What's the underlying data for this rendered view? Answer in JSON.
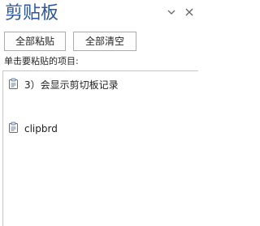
{
  "pane": {
    "title": "剪贴板",
    "icons": {
      "options": "chevron-down-icon",
      "close": "close-icon"
    }
  },
  "actions": {
    "paste_all": "全部粘贴",
    "clear_all": "全部清空"
  },
  "instruction": "单击要粘贴的项目:",
  "items": [
    {
      "text": "3）会显示剪切板记录",
      "icon": "clipboard-text-icon"
    },
    {
      "text": "clipbrd",
      "icon": "clipboard-text-icon"
    }
  ],
  "colors": {
    "title": "#2b579a",
    "border": "#ababab",
    "text": "#262626"
  }
}
